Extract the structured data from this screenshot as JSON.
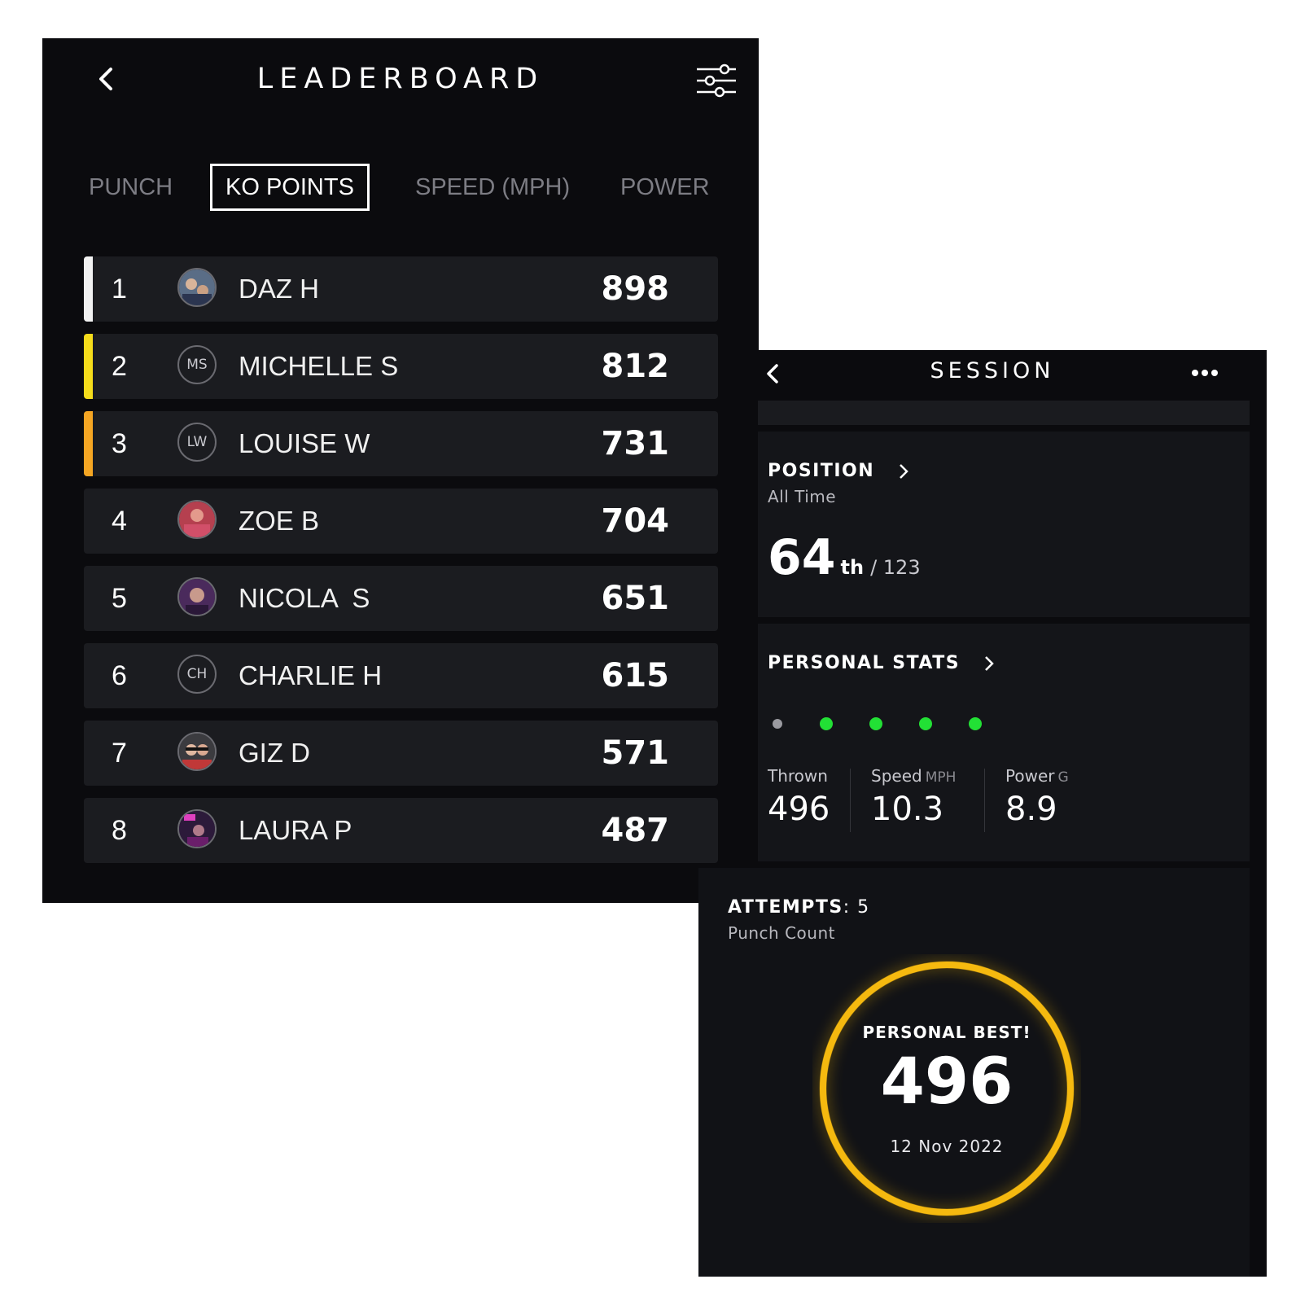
{
  "leaderboard": {
    "title": "LEADERBOARD",
    "tabs": [
      {
        "label": "PUNCH",
        "active": false
      },
      {
        "label": "KO POINTS",
        "active": true
      },
      {
        "label": "SPEED (MPH)",
        "active": false
      },
      {
        "label": "POWER",
        "active": false
      }
    ],
    "rows": [
      {
        "rank": "1",
        "name": "DAZ H",
        "score": "898",
        "avatar": "photo",
        "bar_color": "#f2f2f2"
      },
      {
        "rank": "2",
        "name": "MICHELLE S",
        "score": "812",
        "avatar": "MS",
        "bar_color": "#f5dc1b"
      },
      {
        "rank": "3",
        "name": "LOUISE W",
        "score": "731",
        "avatar": "LW",
        "bar_color": "#f5a623"
      },
      {
        "rank": "4",
        "name": "ZOE B",
        "score": "704",
        "avatar": "photo"
      },
      {
        "rank": "5",
        "name": "NICOLA  S",
        "score": "651",
        "avatar": "photo"
      },
      {
        "rank": "6",
        "name": "CHARLIE H",
        "score": "615",
        "avatar": "CH"
      },
      {
        "rank": "7",
        "name": "GIZ D",
        "score": "571",
        "avatar": "photo"
      },
      {
        "rank": "8",
        "name": "LAURA P",
        "score": "487",
        "avatar": "photo"
      }
    ]
  },
  "session": {
    "title": "SESSION",
    "position": {
      "title": "POSITION",
      "subtitle": "All Time",
      "rank": "64",
      "suffix": "th",
      "total": "/ 123"
    },
    "personal_stats": {
      "title": "PERSONAL STATS",
      "dots": [
        "grey",
        "green",
        "green",
        "green",
        "green"
      ],
      "thrown_label": "Thrown",
      "thrown_value": "496",
      "speed_label": "Speed",
      "speed_unit": "MPH",
      "speed_value": "10.3",
      "power_label": "Power",
      "power_unit": "G",
      "power_value": "8.9"
    },
    "attempts": {
      "title": "ATTEMPTS",
      "count": ": 5",
      "subtitle": "Punch Count",
      "pb_label": "PERSONAL BEST!",
      "pb_value": "496",
      "pb_date": "12 Nov 2022"
    }
  },
  "colors": {
    "background": "#0b0b0e",
    "row": "#1b1c20",
    "accent_ring": "#f5b90f",
    "dot_green": "#22e035"
  }
}
